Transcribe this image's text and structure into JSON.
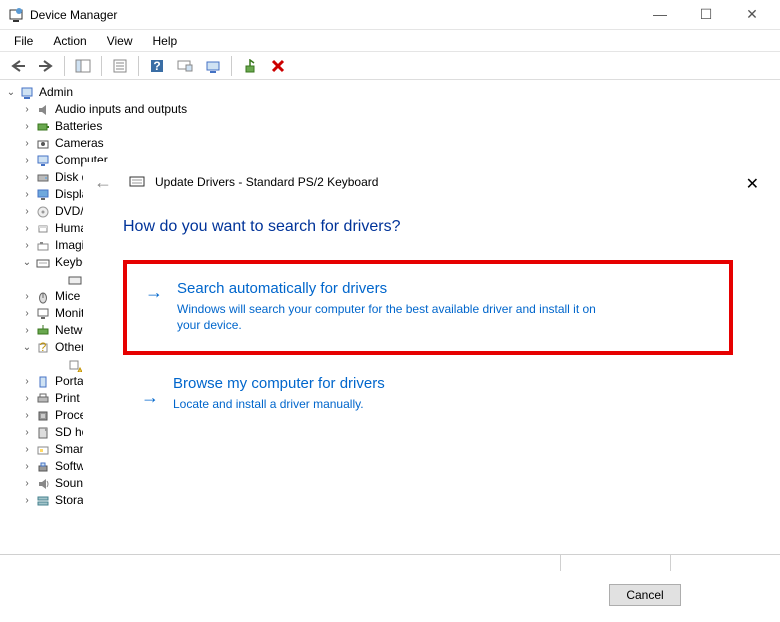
{
  "window": {
    "title": "Device Manager"
  },
  "menu": [
    "File",
    "Action",
    "View",
    "Help"
  ],
  "tree": {
    "root": "Admin",
    "items": [
      {
        "label": "Audio inputs and outputs",
        "icon": "audio",
        "exp": "closed"
      },
      {
        "label": "Batteries",
        "icon": "battery",
        "exp": "closed"
      },
      {
        "label": "Cameras",
        "icon": "camera",
        "exp": "closed"
      },
      {
        "label": "Computer",
        "icon": "computer",
        "exp": "closed"
      },
      {
        "label": "Disk drives",
        "icon": "disk",
        "exp": "closed"
      },
      {
        "label": "Display adapters",
        "icon": "display",
        "exp": "closed"
      },
      {
        "label": "DVD/CD-ROM drives",
        "icon": "dvd",
        "exp": "closed"
      },
      {
        "label": "Human Interface Devices",
        "icon": "hid",
        "exp": "closed"
      },
      {
        "label": "Imaging devices",
        "icon": "imaging",
        "exp": "closed"
      },
      {
        "label": "Keyboards",
        "icon": "keyboard",
        "exp": "open",
        "children": [
          {
            "label": "",
            "icon": "keyboard-item"
          }
        ]
      },
      {
        "label": "Mice and other pointing devices",
        "icon": "mouse",
        "exp": "closed"
      },
      {
        "label": "Monitors",
        "icon": "monitor",
        "exp": "closed"
      },
      {
        "label": "Network adapters",
        "icon": "network",
        "exp": "closed"
      },
      {
        "label": "Other devices",
        "icon": "other",
        "exp": "open",
        "children": [
          {
            "label": "",
            "icon": "warn"
          }
        ]
      },
      {
        "label": "Portable Devices",
        "icon": "portable",
        "exp": "closed"
      },
      {
        "label": "Print queues",
        "icon": "printer",
        "exp": "closed"
      },
      {
        "label": "Processors",
        "icon": "cpu",
        "exp": "closed"
      },
      {
        "label": "SD host adapters",
        "icon": "sd",
        "exp": "closed"
      },
      {
        "label": "Smart card readers",
        "icon": "smartcard",
        "exp": "closed"
      },
      {
        "label": "Software devices",
        "icon": "software",
        "exp": "closed"
      },
      {
        "label": "Sound, video and game controllers",
        "icon": "sound",
        "exp": "closed"
      },
      {
        "label": "Storage controllers",
        "icon": "storage",
        "exp": "closed"
      }
    ]
  },
  "dialog": {
    "title": "Update Drivers - Standard PS/2 Keyboard",
    "question": "How do you want to search for drivers?",
    "option1": {
      "title": "Search automatically for drivers",
      "desc": "Windows will search your computer for the best available driver and install it on your device."
    },
    "option2": {
      "title": "Browse my computer for drivers",
      "desc": "Locate and install a driver manually."
    },
    "cancel": "Cancel"
  }
}
